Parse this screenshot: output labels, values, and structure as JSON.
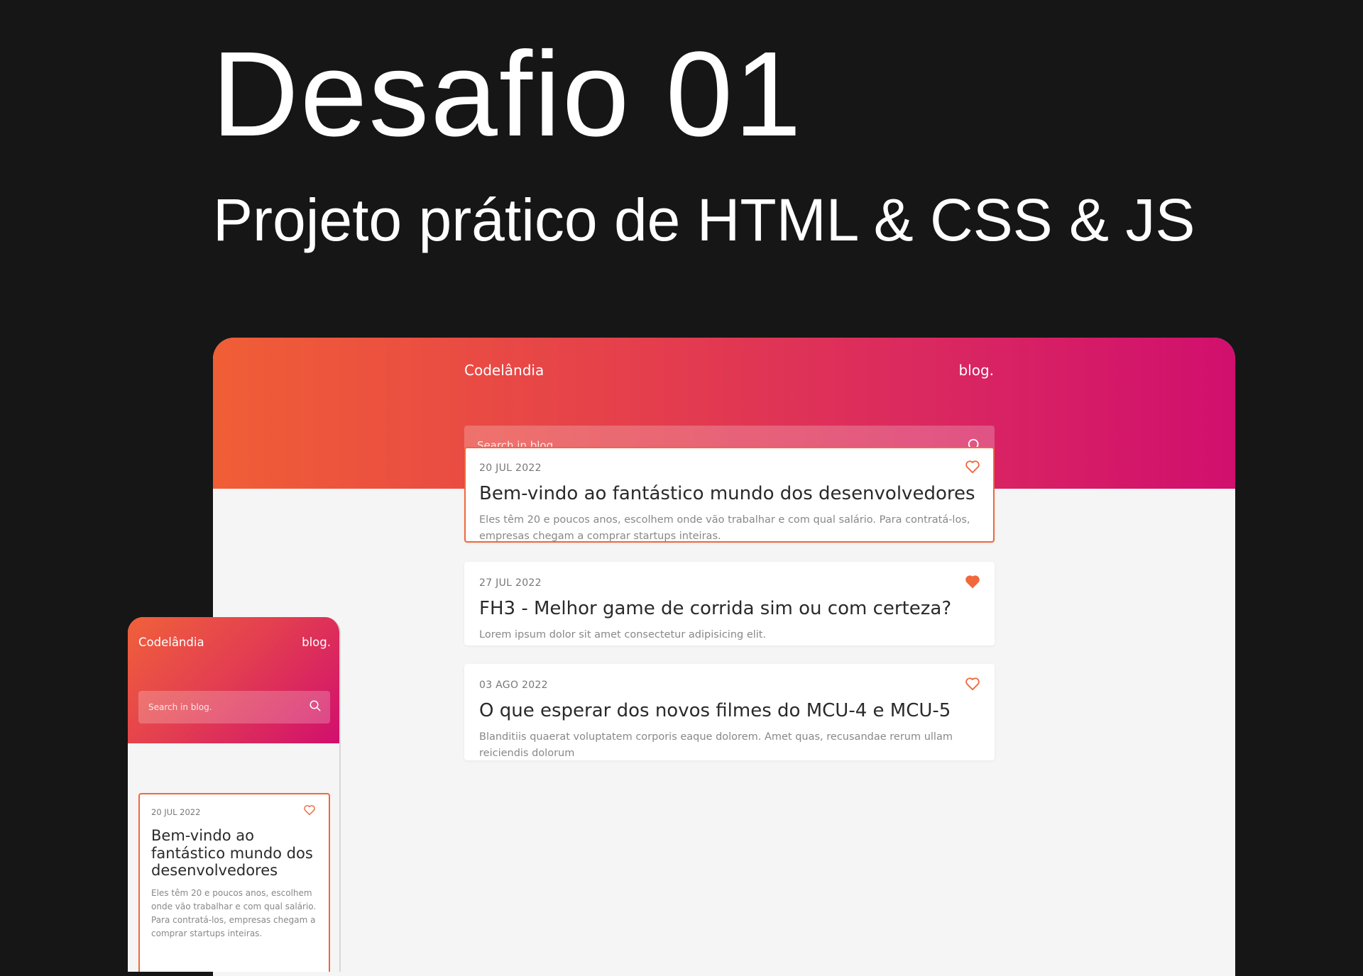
{
  "hero": {
    "title": "Desafio 01",
    "subtitle": "Projeto prático de HTML & CSS & JS"
  },
  "colors": {
    "background": "#161616",
    "gradient_start": "#f05e36",
    "gradient_end": "#d10f6e",
    "accent": "#f0683c",
    "content_bg": "#f5f5f5"
  },
  "desktop": {
    "brand": "Codelândia",
    "blog_label": "blog.",
    "search": {
      "placeholder": "Search in blog.",
      "icon": "search-icon"
    },
    "posts": [
      {
        "date": "20 JUL 2022",
        "title": "Bem-vindo ao fantástico mundo dos desenvolvedores",
        "excerpt": "Eles têm 20 e poucos anos, escolhem onde vão trabalhar e com qual salário. Para contratá-los, empresas chegam a comprar startups inteiras.",
        "liked": false,
        "active": true
      },
      {
        "date": "27 JUL 2022",
        "title": "FH3 - Melhor game de corrida sim ou com certeza?",
        "excerpt": "Lorem ipsum dolor sit amet consectetur adipisicing elit.",
        "liked": true,
        "active": false
      },
      {
        "date": "03 AGO 2022",
        "title": "O que esperar dos novos filmes do MCU-4 e MCU-5",
        "excerpt": "Blanditiis quaerat voluptatem corporis eaque dolorem. Amet quas, recusandae rerum ullam reiciendis dolorum",
        "liked": false,
        "active": false
      }
    ]
  },
  "mobile": {
    "brand": "Codelândia",
    "blog_label": "blog.",
    "search": {
      "placeholder": "Search in blog.",
      "icon": "search-icon"
    },
    "post": {
      "date": "20 JUL 2022",
      "title": "Bem-vindo ao fantástico mundo dos desenvolvedores",
      "excerpt": "Eles têm 20 e poucos anos, escolhem onde vão trabalhar e com qual salário. Para contratá-los, empresas chegam a comprar startups inteiras.",
      "liked": false
    }
  }
}
